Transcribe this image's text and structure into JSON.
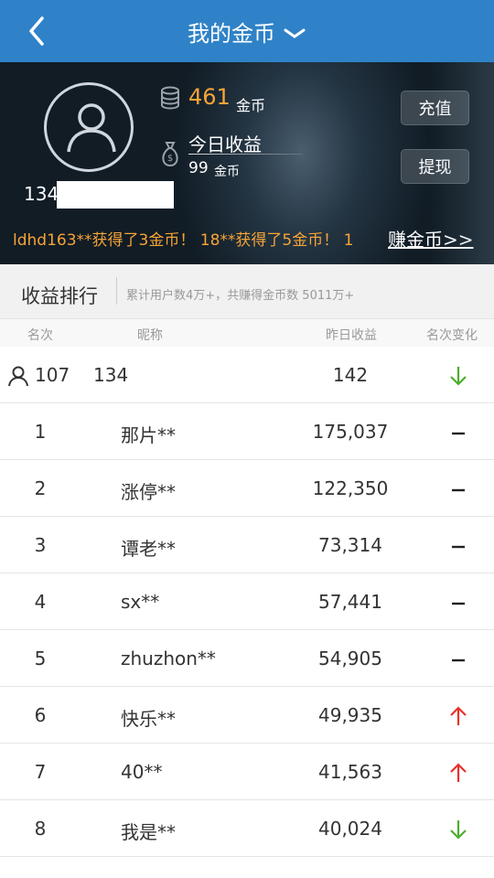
{
  "header": {
    "title": "我的金币"
  },
  "wallet": {
    "coins": "461",
    "coin_unit": "金币",
    "today_label": "今日收益",
    "today_value": "99",
    "today_unit": "金币",
    "user_id": "134",
    "recharge_label": "充值",
    "withdraw_label": "提现",
    "ticker": "ldhd163**获得了3金币！ 18**获得了5金币！ 1",
    "earn_link": "赚金币>>"
  },
  "ranking": {
    "title": "收益排行",
    "subtitle": "累计用户数4万+，共赚得金币数 5011万+",
    "columns": [
      "名次",
      "昵称",
      "昨日收益",
      "名次变化"
    ],
    "me": {
      "rank": "107",
      "name": "134",
      "earn": "142",
      "change": "down"
    },
    "rows": [
      {
        "rank": "1",
        "name": "那片**",
        "earn": "175,037",
        "change": "same"
      },
      {
        "rank": "2",
        "name": "涨停**",
        "earn": "122,350",
        "change": "same"
      },
      {
        "rank": "3",
        "name": "谭老**",
        "earn": "73,314",
        "change": "same"
      },
      {
        "rank": "4",
        "name": "sx**",
        "earn": "57,441",
        "change": "same"
      },
      {
        "rank": "5",
        "name": "zhuzhon**",
        "earn": "54,905",
        "change": "same"
      },
      {
        "rank": "6",
        "name": "快乐**",
        "earn": "49,935",
        "change": "up"
      },
      {
        "rank": "7",
        "name": "40**",
        "earn": "41,563",
        "change": "up"
      },
      {
        "rank": "8",
        "name": "我是**",
        "earn": "40,024",
        "change": "down"
      }
    ]
  },
  "colors": {
    "header_bg": "#2f82c7",
    "coin": "#f7a437",
    "up": "#e8322b",
    "down": "#4cae2e",
    "same": "#222222"
  },
  "icons": {
    "back": "chevron-left-icon",
    "title": "chevron-down-icon",
    "coin": "coin-stack-icon",
    "bag": "money-bag-icon",
    "user": "user-icon"
  }
}
